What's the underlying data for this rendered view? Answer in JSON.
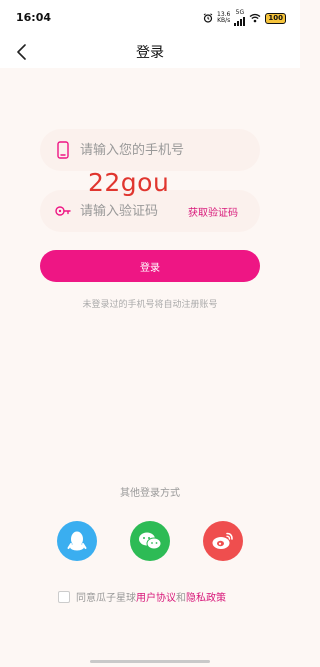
{
  "status": {
    "time": "16:04",
    "net_speed_value": "13.6",
    "net_speed_unit": "KB/s",
    "network": "5G",
    "battery": "100"
  },
  "nav": {
    "title": "登录"
  },
  "form": {
    "phone_placeholder": "请输入您的手机号",
    "code_placeholder": "请输入验证码",
    "get_code_label": "获取验证码",
    "login_label": "登录",
    "hint": "未登录过的手机号将自动注册账号"
  },
  "watermark": "22gou",
  "other_login": {
    "title": "其他登录方式",
    "icons": [
      "qq-icon",
      "wechat-icon",
      "weibo-icon"
    ]
  },
  "agreement": {
    "prefix": "同意瓜子星球",
    "user_agreement": "用户协议",
    "and": "和",
    "privacy_policy": "隐私政策"
  },
  "colors": {
    "accent": "#ee1684",
    "link": "#d8187a",
    "qq": "#3aaef0",
    "wechat": "#2dbb55",
    "weibo": "#ef4e4e",
    "background": "#fdf7f4"
  }
}
